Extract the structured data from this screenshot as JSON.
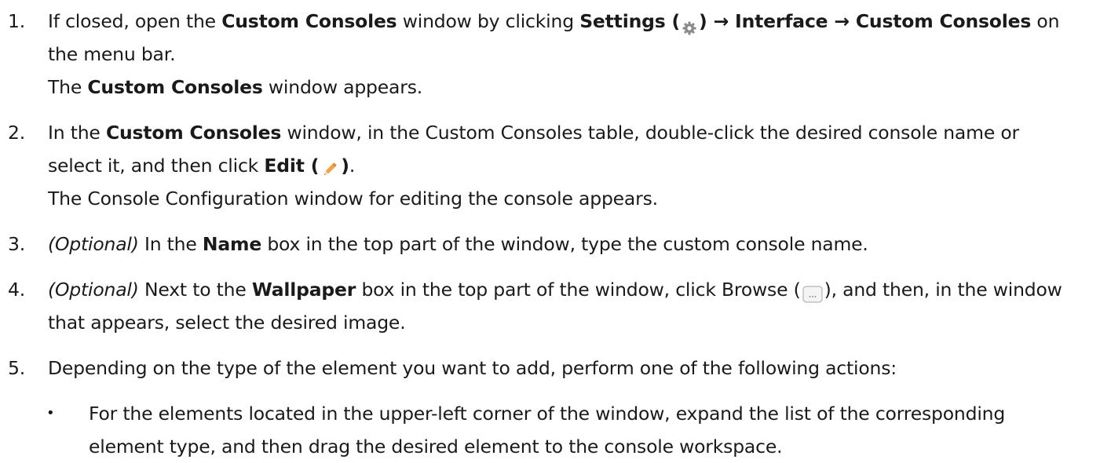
{
  "steps": [
    {
      "num": "1.",
      "l1_a": "If closed, open the ",
      "l1_b": "Custom Consoles",
      "l1_c": " window by clicking ",
      "l1_d": "Settings (",
      "l1_e": ") → Interface → Custom Consoles",
      "l1_f": " on",
      "l2": "the menu bar.",
      "l3_a": "The ",
      "l3_b": "Custom Consoles",
      "l3_c": " window appears."
    },
    {
      "num": "2.",
      "l1_a": "In the ",
      "l1_b": "Custom Consoles",
      "l1_c": " window, in the Custom Consoles table, double-click the desired console name or",
      "l2_a": "select it, and then click ",
      "l2_b": "Edit (",
      "l2_c": ")",
      "l2_d": ".",
      "l3": "The Console Configuration window for editing the console appears."
    },
    {
      "num": "3.",
      "l1_a": "(Optional)",
      "l1_b": " In the ",
      "l1_c": "Name",
      "l1_d": " box in the top part of the window, type the custom console name."
    },
    {
      "num": "4.",
      "l1_a": "(Optional)",
      "l1_b": " Next to the ",
      "l1_c": "Wallpaper",
      "l1_d": " box in the top part of the window, click Browse (",
      "l1_e": "), and then, in the window",
      "l2": "that appears, select the desired image."
    },
    {
      "num": "5.",
      "l1": "Depending on the type of the element you want to add, perform one of the following actions:",
      "bullets": [
        {
          "mark": "•",
          "l1": "For the elements located in the upper-left corner of the window, expand the list of the corresponding",
          "l2": "element type, and then drag the desired element to the console workspace."
        }
      ]
    }
  ],
  "icons": {
    "settings": "gear-icon",
    "edit": "pencil-icon",
    "browse": "ellipsis-button-icon"
  },
  "colors": {
    "text": "#1a1a1a",
    "gear": "#8a8a8a",
    "pencil": "#f2a33a"
  }
}
